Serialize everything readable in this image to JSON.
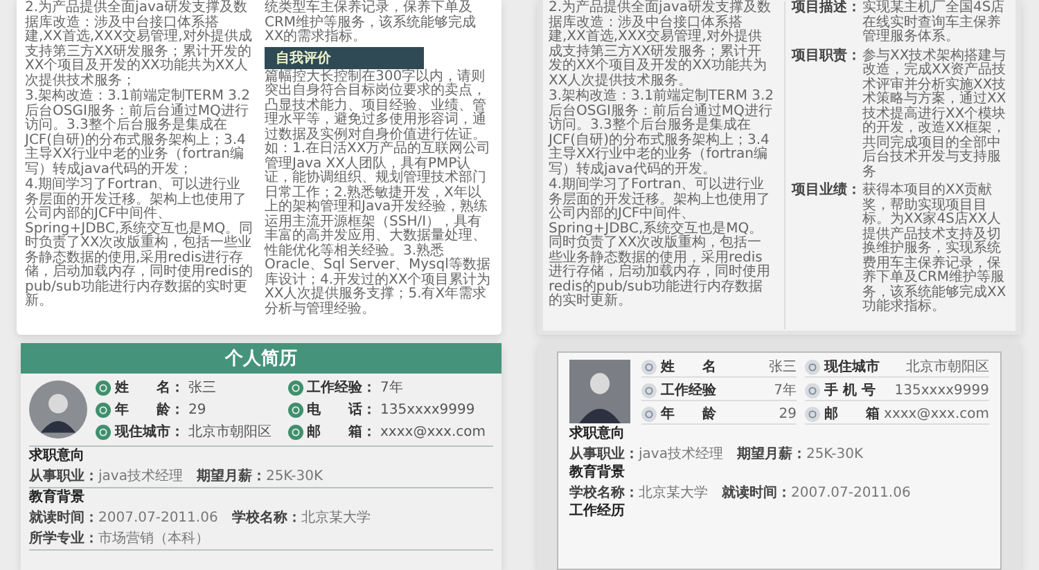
{
  "template_1": {
    "left_paragraphs": [
      "2.为产品提供全面java研发支撑及数据库改造：涉及中台接口体系搭建,XX首选,XXX交易管理,对外提供成支持第三方XX研发服务；累计开发的XX个项目及开发的XX功能共为XX人次提供技术服务；",
      "3.架构改造：3.1前端定制TERM 3.2后台OSGI服务：前后台通过MQ进行访问。3.3整个后台服务是集成在JCF(自研)的分布式服务架构上；3.4主导XX行业中老的业务（fortran编写）转成java代码的开发；",
      "4.期间学习了Fortran、可以进行业务层面的开发迁移。架构上也使用了公司内部的JCF中间件、Spring+JDBC,系统交互也是MQ。同时负责了XX次改版重构，包括一些业务静态数据的使用,采用redis进行存储，启动加载内存，同时使用redis的pub/sub功能进行内存数据的实时更新。"
    ],
    "right_intro": "统类型车主保养记录，保养下单及CRM维护等服务，该系统能够完成XX的需求指标。",
    "section_title": "自我评价",
    "section_text": "篇幅控大长控制在300字以内，请则突出自身符合目标岗位要求的卖点，凸显技术能力、项目经验、业绩、管理水平等，避免过多使用形容词，通过数据及实例对自身价值进行佐证。如：1.在日活XX万产品的互联网公司管理Java XX人团队，具有PMP认证，能协调组织、规划管理技术部门日常工作；2.熟悉敏捷开发，X年以上的架构管理和Java开发经验，熟练运用主流开源框架（SSH/I），具有丰富的高并发应用、大数据量处理、性能优化等相关经验。3.熟悉Oracle、Sql Server、Mysql等数据库设计；4.开发过的XX个项目累计为XX人次提供服务支撑；5.有X年需求分析与管理经验。"
  },
  "template_2": {
    "left_paragraphs": [
      "2.为产品提供全面java研发支撑及数据库改造：涉及中台接口体系搭建,XX首选,XXX交易管理,对外提供成支持第三方XX研发服务；累计开发的XX个项目及开发的XX功能共为XX人次提供技术服务。",
      "3.架构改造：3.1前端定制TERM 3.2后台OSGI服务：前后台通过MQ进行访问。3.3整个后台服务是集成在JCF(自研)的分布式服务架构上；3.4主导XX行业中老的业务（fortran编写）转成java代码的开发。",
      "4.期间学习了Fortran、可以进行业务层面的开发迁移。架构上也使用了公司内部的JCF中间件、Spring+JDBC,系统交互也是MQ。同时负责了XX次改版重构，包括一些业务静态数据的使用，采用redis进行存储，启动加载内存，同时使用redis的pub/sub功能进行内存数据的实时更新。"
    ],
    "items": [
      {
        "label": "项目描述：",
        "text": "实现某主机厂全国4S店在线实时查询车主保养管理服务体系。"
      },
      {
        "label": "项目职责：",
        "text": "参与XX技术架构搭建与改造，完成XX资产品技术评审并分析实施XX技术策略与方案，通过XX技术提高进行XX个模块的开发，改造XX框架，共同完成项目的全部中后台技术开发与支持服务"
      },
      {
        "label": "项目业绩：",
        "text": "获得本项目的XX贡献奖，帮助实现项目目标。为XX家4S店XX人提供产品技术支持及切换维护服务，实现系统费用车主保养记录，保养下单及CRM维护等服务，该系统能够完成XX功能求指标。"
      }
    ]
  },
  "template_3": {
    "title": "个人简历",
    "fields": [
      {
        "label": "姓　　名：",
        "value": "张三"
      },
      {
        "label": "工作经验：",
        "value": "7年"
      },
      {
        "label": "年　　龄：",
        "value": "29"
      },
      {
        "label": "电　　话：",
        "value": "135xxxx9999"
      },
      {
        "label": "现住城市：",
        "value": "北京市朝阳区"
      },
      {
        "label": "邮　　箱：",
        "value": "xxxx@xxx.com"
      }
    ],
    "sections": [
      {
        "heading": "求职意向",
        "items": [
          {
            "label": "从事职业：",
            "value": "java技术经理"
          },
          {
            "label": "期望月薪：",
            "value": "25K-30K"
          }
        ]
      },
      {
        "heading": "教育背景",
        "items": [
          {
            "label": "就读时间：",
            "value": "2007.07-2011.06"
          },
          {
            "label": "学校名称：",
            "value": "北京某大学"
          },
          {
            "label": "所学专业：",
            "value": "市场营销（本科）"
          }
        ]
      }
    ]
  },
  "template_4": {
    "fields": [
      {
        "label": "姓　　名",
        "value": "张三"
      },
      {
        "label": "现住城市",
        "value": "北京市朝阳区"
      },
      {
        "label": "工作经验",
        "value": "7年"
      },
      {
        "label": "手 机 号",
        "value": "135xxxx9999"
      },
      {
        "label": "年　　龄",
        "value": "29"
      },
      {
        "label": "邮　　箱",
        "value": "xxxx@xxx.com"
      }
    ],
    "sections": [
      {
        "heading": "求职意向",
        "items": [
          {
            "label": "从事职业：",
            "value": "java技术经理"
          },
          {
            "label": "期望月薪：",
            "value": "25K-30K"
          }
        ]
      },
      {
        "heading": "教育背景",
        "items": [
          {
            "label": "学校名称：",
            "value": "北京某大学"
          },
          {
            "label": "就读时间：",
            "value": "2007.07-2011.06"
          }
        ]
      },
      {
        "heading": "工作经历"
      }
    ]
  }
}
